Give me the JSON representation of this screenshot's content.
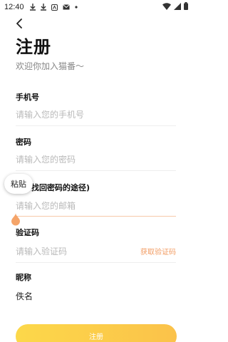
{
  "status_bar": {
    "time": "12:40"
  },
  "header": {
    "title": "注册",
    "subtitle": "欢迎你加入猫番～"
  },
  "form": {
    "phone": {
      "label": "手机号",
      "placeholder": "请输入您的手机号"
    },
    "password": {
      "label": "密码",
      "placeholder": "请输入您的密码"
    },
    "email": {
      "label": "找回密码的途径)",
      "placeholder": "请输入您的邮箱"
    },
    "code": {
      "label": "验证码",
      "placeholder": "请输入验证码",
      "get_code": "获取验证码"
    },
    "nickname": {
      "label": "昵称",
      "value": "佚名"
    }
  },
  "context_menu": {
    "paste": "粘贴"
  },
  "register_button": "注册",
  "colors": {
    "accent": "#f29c63",
    "button_start": "#fcd84a",
    "button_end": "#fbc24a",
    "cursor_handle": "#f5a469"
  }
}
